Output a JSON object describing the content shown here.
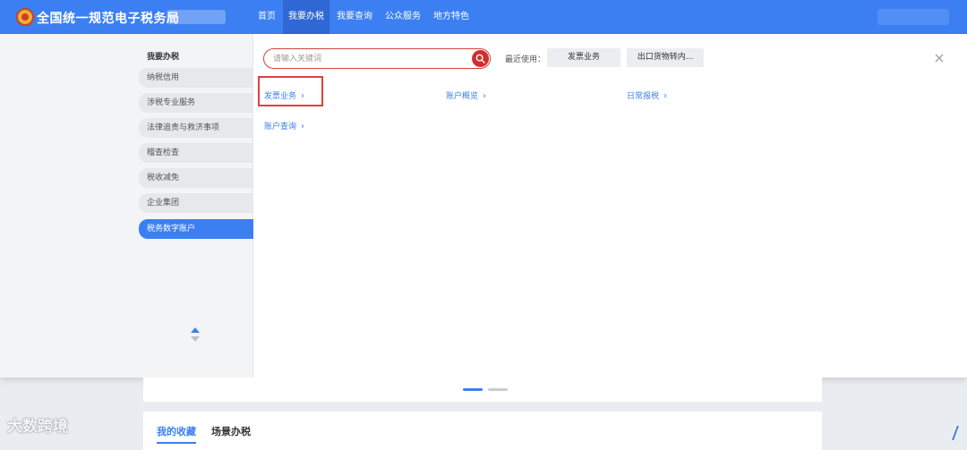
{
  "header": {
    "site_title": "全国统一规范电子税务局",
    "nav": [
      {
        "label": "首页"
      },
      {
        "label": "我要办税",
        "active": true
      },
      {
        "label": "我要查询"
      },
      {
        "label": "公众服务"
      },
      {
        "label": "地方特色"
      }
    ],
    "brand_color": "#3b7ff2"
  },
  "sidebar": {
    "heading": "我要办税",
    "items": [
      {
        "label": "纳税信用"
      },
      {
        "label": "涉税专业服务"
      },
      {
        "label": "法律追责与救济事项"
      },
      {
        "label": "稽查检查"
      },
      {
        "label": "税收减免"
      },
      {
        "label": "企业集团"
      },
      {
        "label": "税务数字账户",
        "active": true
      }
    ]
  },
  "search": {
    "placeholder": "请输入关键词",
    "value": ""
  },
  "recent": {
    "label": "最近使用：",
    "items": [
      "发票业务",
      "出口货物转内..."
    ]
  },
  "categories": [
    {
      "label": "发票业务",
      "highlighted": true
    },
    {
      "label": "账户概览"
    },
    {
      "label": "日常报税"
    },
    {
      "label": "账户查询"
    }
  ],
  "carousel": {
    "total": 2,
    "current": 1
  },
  "tabs": [
    {
      "label": "我的收藏",
      "active": true
    },
    {
      "label": "场景办税"
    }
  ],
  "watermark": "大数跨境",
  "colors": {
    "accent": "#3b7ff2",
    "highlight": "#e0413b",
    "search_border": "#d2453a"
  }
}
